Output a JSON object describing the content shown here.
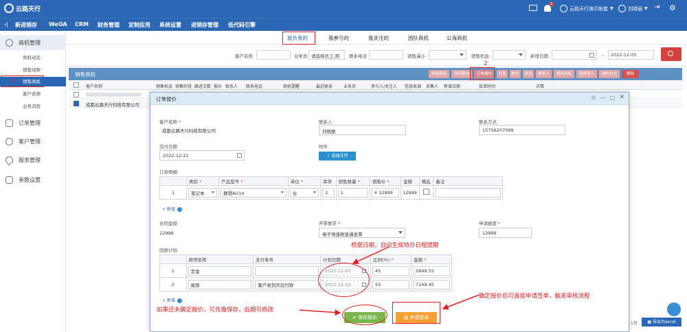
{
  "app": {
    "logo": "云路天行"
  },
  "header": {
    "tenant": "云路天行演示账套",
    "user": "刘晓丽",
    "badge": "5"
  },
  "nav": [
    "新进销存",
    "WeOA",
    "CRM",
    "财务管理",
    "定制应用",
    "系统设置",
    "进销存管理",
    "低代码引擎"
  ],
  "sidebar": {
    "groups": [
      {
        "label": "商机管理",
        "icon": "target-icon",
        "items": [
          "商机动态",
          "销售线索",
          "销售商机",
          "客户资源",
          "业务流程"
        ]
      },
      {
        "label": "订单管理",
        "icon": "document-icon"
      },
      {
        "label": "客户管理",
        "icon": "users-icon"
      },
      {
        "label": "服务管理",
        "icon": "heart-icon"
      },
      {
        "label": "参数设置",
        "icon": "list-icon"
      }
    ],
    "active": "销售商机"
  },
  "tabs": [
    "我负责的",
    "我参与的",
    "我关注的",
    "团队商机",
    "公海商机"
  ],
  "filters": {
    "customer_label": "客户名称",
    "owner_label": "业务员",
    "owner_value": "请选择员工,用",
    "phone_label": "联系电话",
    "stage_label": "销售漏斗",
    "opportunity_label": "销售机会",
    "date_label": "新增日期",
    "date_to": "2022-12-05"
  },
  "panel": {
    "title": "销售商机",
    "buttons": [
      "新增商机",
      "商机跟进",
      "订单报价",
      "共享",
      "移交",
      "邀请",
      "联系人",
      "修改商机",
      "商机导入",
      "操作日志",
      "删除"
    ],
    "columns": [
      "客户名称",
      "销售机会",
      "销售阶段",
      "跟进次数",
      "报价",
      "联系人",
      "联系电话",
      "商机提醒",
      "最近联系",
      "业务员",
      "参与人/关注人",
      "信息来源",
      "采集人",
      "新增日期",
      "拾单时间",
      "详情"
    ],
    "rows": [
      {
        "name": "",
        "checked": false
      },
      {
        "name": "成都云路天行科技有限公司",
        "checked": true
      }
    ]
  },
  "modal": {
    "title": "订单报价",
    "customer_label": "客户名称",
    "customer": "成都云路天行科技有限公司",
    "contact_label": "联系人",
    "contact": "刘晓丽",
    "phone_label": "联系方式",
    "phone": "15756207099",
    "delivery_label": "交付日期",
    "delivery": "2022-12-21",
    "attachment_label": "附件",
    "upload": "选择文件",
    "detail_label": "订单明细",
    "items_headers": [
      "类别",
      "产品型号",
      "单位",
      "库存",
      "销售数量",
      "销售价",
      "金额",
      "赠品",
      "备注"
    ],
    "items": [
      {
        "no": "1",
        "category": "笔记本",
        "model": "联想Air14",
        "unit": "台",
        "stock": "2",
        "qty": "1",
        "price": "¥ 12999",
        "amount": "12999"
      }
    ],
    "add": "+ 新增",
    "contract_label": "合同金额",
    "contract": "12999",
    "invoice_label": "开票要求",
    "invoice": "电子增值税普通发票",
    "apply_amount_label": "申请额度",
    "apply_amount": "12999",
    "plan_label": "回款计划",
    "plan_headers": [
      "款项名称",
      "支付条件",
      "计划日期",
      "比例(%)",
      "金额"
    ],
    "plan": [
      {
        "no": "1",
        "name": "定金",
        "cond": "",
        "date": "2022-12-05",
        "ratio": "45",
        "amount": "5849.55"
      },
      {
        "no": "2",
        "name": "尾款",
        "cond": "客户收到货后付款",
        "date": "2022-12-22",
        "ratio": "55",
        "amount": "7149.45"
      }
    ],
    "save": "保存报价",
    "apply": "申请签单"
  },
  "annotations": {
    "step1": "1",
    "step2": "2",
    "date_note": "根据日期，自动生成待办日程提醒",
    "save_note": "如果还未确定报价，可先做保存，后期可修改",
    "apply_note": "确定报价后可直接申请签单，触发审核流程"
  },
  "footer": {
    "export": "导出为excel",
    "page_suffix": "1页"
  }
}
